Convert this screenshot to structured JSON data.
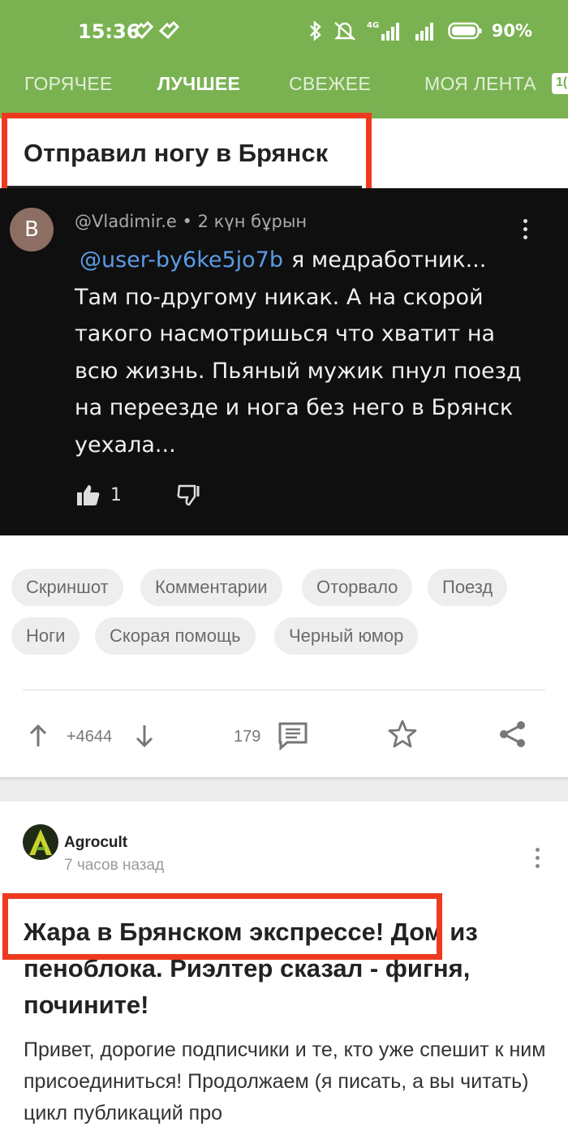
{
  "status_bar": {
    "time": "15:36",
    "network": "4G",
    "battery": "90%"
  },
  "tabs": [
    {
      "label": "ГОРЯЧЕЕ",
      "active": false
    },
    {
      "label": "ЛУЧШЕЕ",
      "active": true
    },
    {
      "label": "СВЕЖЕЕ",
      "active": false
    },
    {
      "label": "МОЯ ЛЕНТА",
      "active": false
    }
  ],
  "tab_badge": "1(",
  "post1": {
    "title": "Отправил ногу в Брянск",
    "screenshot": {
      "avatar_letter": "B",
      "meta": "@Vladimir.e • 2 күн бұрын",
      "mention": "@user-by6ke5jo7b",
      "text_line1": "я медработник...",
      "text_rest": "Там по-другому никак. А на скорой такого насмотришься что  хватит на всю жизнь. Пьяный мужик пнул поезд на переезде и нога без него в Брянск уехала...",
      "likes": "1"
    },
    "tags": [
      "Скриншот",
      "Комментарии",
      "Оторвало",
      "Поезд",
      "Ноги",
      "Скорая помощь",
      "Черный юмор"
    ],
    "rating": "+4644",
    "comments": "179"
  },
  "post2": {
    "author": "Agrocult",
    "time": "7 часов назад",
    "title": "Жара в Брянском экспрессе! Дом из пеноблока. Риэлтер сказал - фигня, почините!",
    "body": "Привет, дорогие подписчики и те, кто уже спешит к ним присоединиться! Продолжаем (я писать, а вы читать) цикл публикаций про"
  },
  "colors": {
    "brand": "#7ab252",
    "highlight": "#ee3a1f",
    "mention": "#5b9be6"
  }
}
